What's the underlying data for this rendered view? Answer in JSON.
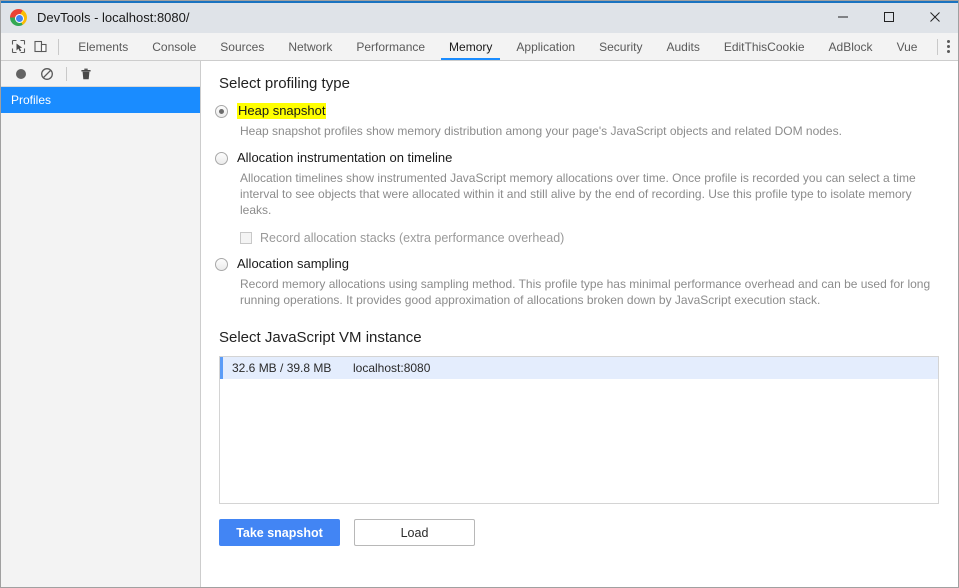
{
  "window": {
    "title": "DevTools - localhost:8080/",
    "logo_icon": "chrome-logo-icon",
    "minimize_icon": "minimize-icon",
    "maximize_icon": "maximize-icon",
    "close_icon": "close-icon"
  },
  "toolbar": {
    "inspect_icon": "inspect-element-icon",
    "device_icon": "device-toolbar-icon",
    "more_icon": "more-options-kebab-icon",
    "tabs": [
      {
        "label": "Elements",
        "active": false
      },
      {
        "label": "Console",
        "active": false
      },
      {
        "label": "Sources",
        "active": false
      },
      {
        "label": "Network",
        "active": false
      },
      {
        "label": "Performance",
        "active": false
      },
      {
        "label": "Memory",
        "active": true
      },
      {
        "label": "Application",
        "active": false
      },
      {
        "label": "Security",
        "active": false
      },
      {
        "label": "Audits",
        "active": false
      },
      {
        "label": "EditThisCookie",
        "active": false
      },
      {
        "label": "AdBlock",
        "active": false
      },
      {
        "label": "Vue",
        "active": false
      }
    ]
  },
  "sidebar": {
    "record_icon": "record-circle-icon",
    "clear_icon": "clear-no-entry-icon",
    "delete_icon": "trash-bin-icon",
    "items": [
      {
        "label": "Profiles",
        "selected": true
      }
    ]
  },
  "main": {
    "profiling_type_heading": "Select profiling type",
    "options": [
      {
        "label": "Heap snapshot",
        "selected": true,
        "highlighted": true,
        "description": "Heap snapshot profiles show memory distribution among your page's JavaScript objects and related DOM nodes."
      },
      {
        "label": "Allocation instrumentation on timeline",
        "selected": false,
        "highlighted": false,
        "description": "Allocation timelines show instrumented JavaScript memory allocations over time. Once profile is recorded you can select a time interval to see objects that were allocated within it and still alive by the end of recording. Use this profile type to isolate memory leaks."
      },
      {
        "label": "Allocation sampling",
        "selected": false,
        "highlighted": false,
        "description": "Record memory allocations using sampling method. This profile type has minimal performance overhead and can be used for long running operations. It provides good approximation of allocations broken down by JavaScript execution stack."
      }
    ],
    "record_stacks_checkbox": {
      "label": "Record allocation stacks (extra performance overhead)",
      "checked": false,
      "disabled": true
    },
    "vm_instance_heading": "Select JavaScript VM instance",
    "vm_rows": [
      {
        "size": "32.6 MB / 39.8 MB",
        "host": "localhost:8080",
        "selected": true
      }
    ],
    "take_snapshot_label": "Take snapshot",
    "load_label": "Load"
  },
  "colors": {
    "accent_blue": "#1a8cff",
    "primary_button": "#4285f4",
    "highlight_yellow": "#ffff00",
    "selected_row": "#e4edfd",
    "titlebar": "#dfe3e8"
  }
}
